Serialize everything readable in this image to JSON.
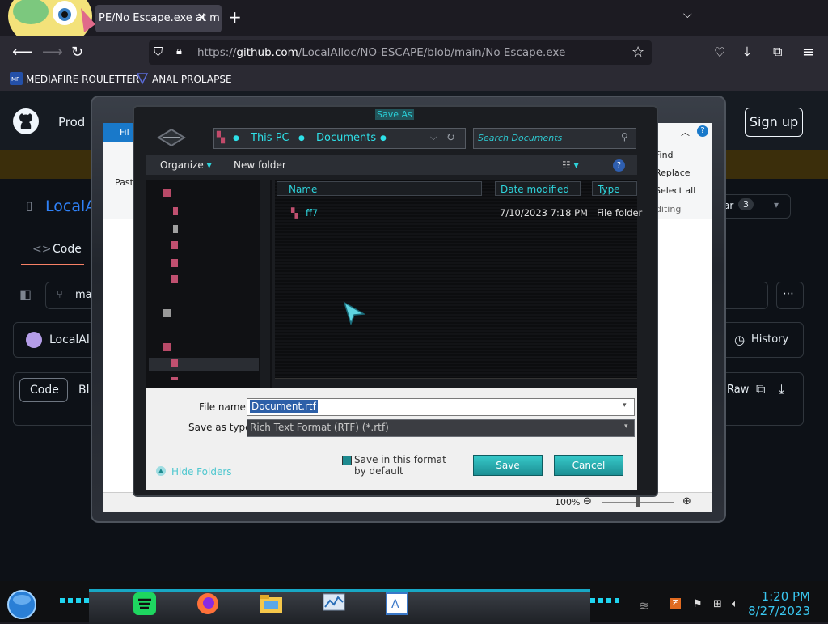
{
  "browser": {
    "tab_title": "PE/No Escape.exe at m",
    "tab_close": "✕",
    "new_tab": "+",
    "url_prefix": "https://",
    "url_host": "github.com",
    "url_path": "/LocalAlloc/NO-ESCAPE/blob/main/No Escape.exe",
    "bookmarks": [
      {
        "label": "MEDIAFIRE ROULETTER",
        "icon": "mediafire-icon"
      },
      {
        "label": "ANAL PROLAPSE",
        "icon": "bookmark-icon"
      }
    ]
  },
  "github": {
    "product_nav": "Prod",
    "signup": "Sign up",
    "repo_owner": "LocalA",
    "code_tab": "Code",
    "branch": "ma",
    "commit_author": "LocalAll",
    "history": "History",
    "code_button": "Code",
    "blame_button": "Bl",
    "raw_button": "Raw",
    "star_count": "3",
    "star_label": "ar"
  },
  "wordpad": {
    "file_tab": "Fil",
    "paste": "Past",
    "find": "Find",
    "replace": "Replace",
    "select_all": "Select all",
    "editing": "Editing",
    "zoom": "100%"
  },
  "dialog": {
    "title": "Save As",
    "breadcrumbs": [
      "This PC",
      "Documents"
    ],
    "search_placeholder": "Search Documents",
    "organize": "Organize",
    "new_folder": "New folder",
    "columns": [
      "Name",
      "Date modified",
      "Type"
    ],
    "files": [
      {
        "name": "ff7",
        "date_modified": "7/10/2023 7:18 PM",
        "type": "File folder"
      }
    ],
    "file_name_label": "File name:",
    "file_name_value": "Document.rtf",
    "save_as_type_label": "Save as type:",
    "save_as_type_value": "Rich Text Format (RTF) (*.rtf)",
    "default_format_checkbox": "Save in this format by default",
    "hide_folders": "Hide Folders",
    "save_button": "Save",
    "cancel_button": "Cancel"
  },
  "taskbar": {
    "time": "1:20 PM",
    "date": "8/27/2023"
  },
  "colors": {
    "accent_cyan": "#2ee0e8",
    "github_bg": "#0d1117",
    "firefox_bg": "#1c1b22"
  }
}
